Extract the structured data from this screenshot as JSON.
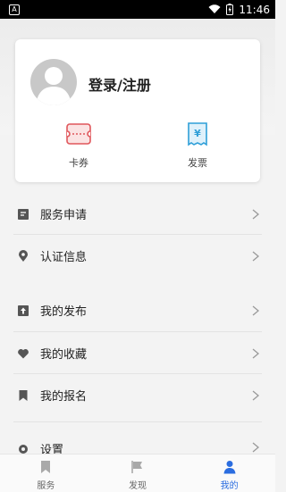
{
  "status_bar": {
    "time": "11:46",
    "app_indicator": "A"
  },
  "profile": {
    "login_label": "登录/注册"
  },
  "quick_actions": [
    {
      "label": "卡券",
      "icon": "coupon-icon",
      "color": "#e0565b"
    },
    {
      "label": "发票",
      "icon": "invoice-icon",
      "color": "#2f9fd8"
    }
  ],
  "menu": [
    {
      "label": "服务申请",
      "icon": "document-icon"
    },
    {
      "label": "认证信息",
      "icon": "location-pin-icon"
    },
    {
      "label": "我的发布",
      "icon": "upload-icon"
    },
    {
      "label": "我的收藏",
      "icon": "heart-icon"
    },
    {
      "label": "我的报名",
      "icon": "bookmark-icon"
    },
    {
      "label": "设置",
      "icon": "gear-icon"
    }
  ],
  "tabs": [
    {
      "label": "服务",
      "icon": "bookmark-icon",
      "active": false
    },
    {
      "label": "发现",
      "icon": "flag-icon",
      "active": false
    },
    {
      "label": "我的",
      "icon": "person-icon",
      "active": true
    }
  ],
  "colors": {
    "accent": "#2b6de0",
    "icon_gray": "#555555"
  }
}
